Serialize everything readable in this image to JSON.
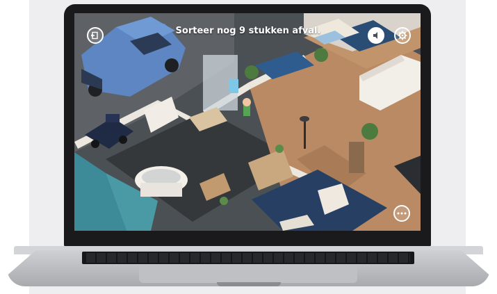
{
  "game": {
    "instruction": "Sorteer nog 9 stukken afval.",
    "buttons": {
      "exit_icon": "exit-door-icon",
      "sound_icon": "speaker-icon",
      "settings_icon": "gear-icon",
      "more_icon": "more-dots-icon"
    }
  },
  "colors": {
    "floor_wood": "#b98a63",
    "floor_tile": "#35383b",
    "rug_blue": "#263f63",
    "car_blue": "#5d86c2",
    "pool_water": "#3d8a98",
    "wall_white": "#ece7df"
  }
}
